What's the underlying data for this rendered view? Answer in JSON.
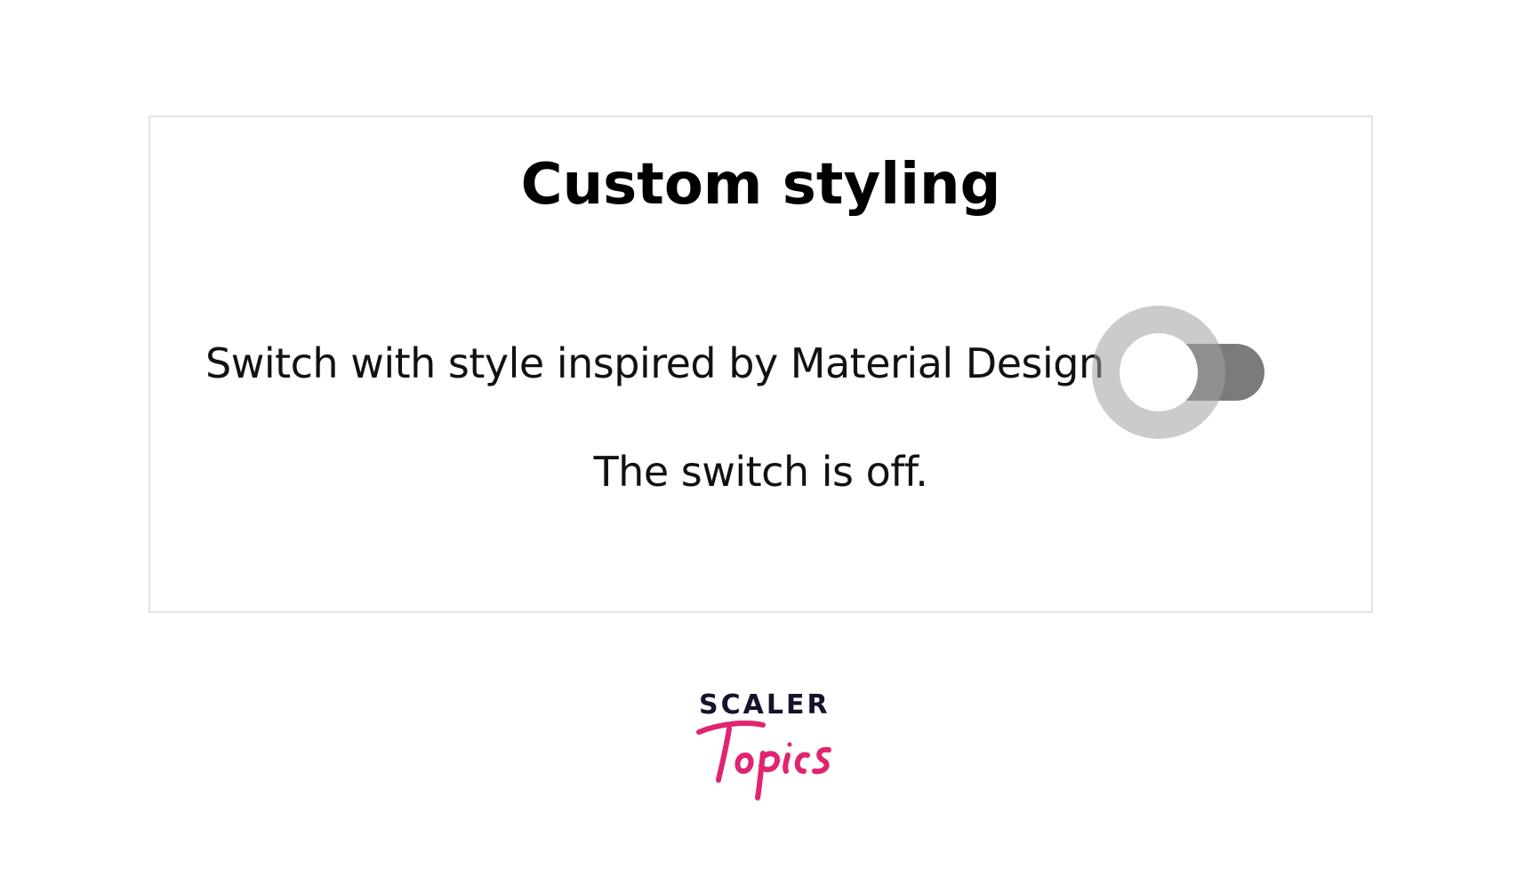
{
  "card": {
    "title": "Custom styling",
    "switch_label": "Switch with style inspired by Material Design",
    "switch_state": "off",
    "status_text": "The switch is off."
  },
  "colors": {
    "track": "#7b7b7b",
    "halo": "#a0a0a0",
    "thumb": "#ffffff",
    "border": "#e3e3e3",
    "logo_dark": "#13132d",
    "logo_pink": "#e0246f"
  },
  "logo": {
    "wordmark_top": "SCALER",
    "wordmark_bottom": "Topics"
  }
}
